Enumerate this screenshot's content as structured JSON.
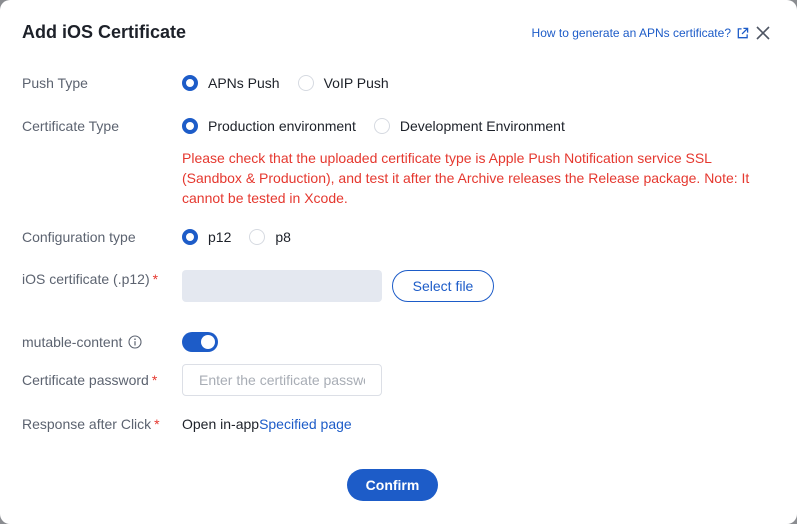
{
  "dialog": {
    "title": "Add iOS Certificate",
    "help_link": "How to generate an APNs certificate?"
  },
  "push_type": {
    "label": "Push Type",
    "options": [
      "APNs Push",
      "VoIP Push"
    ],
    "selected": "APNs Push"
  },
  "certificate_type": {
    "label": "Certificate Type",
    "options": [
      "Production environment",
      "Development Environment"
    ],
    "selected": "Production environment",
    "warning": "Please check that the uploaded certificate type is Apple Push Notification service SSL (Sandbox & Production), and test it after the Archive releases the Release package. Note: It cannot be tested in Xcode."
  },
  "configuration_type": {
    "label": "Configuration type",
    "options": [
      "p12",
      "p8"
    ],
    "selected": "p12"
  },
  "ios_certificate": {
    "label": "iOS certificate (.p12)",
    "required": "*",
    "select_file_label": "Select file"
  },
  "mutable_content": {
    "label": "mutable-content",
    "enabled": true
  },
  "certificate_password": {
    "label": "Certificate password",
    "required": "*",
    "placeholder": "Enter the certificate password",
    "value": ""
  },
  "response_after_click": {
    "label": "Response after Click",
    "required": "*",
    "value": "Open in-app",
    "link": "Specified page"
  },
  "footer": {
    "confirm_label": "Confirm"
  },
  "colors": {
    "accent": "#1d5cc8",
    "warning": "#e5382f",
    "label": "#5c6370"
  }
}
